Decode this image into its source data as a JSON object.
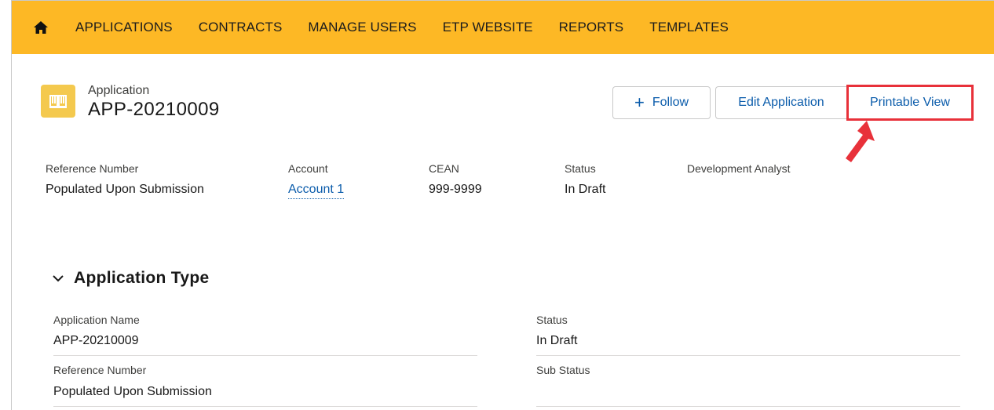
{
  "nav": {
    "home_icon": "home-icon",
    "items": [
      "APPLICATIONS",
      "CONTRACTS",
      "MANAGE USERS",
      "ETP WEBSITE",
      "REPORTS",
      "TEMPLATES"
    ],
    "background": "#fdb825"
  },
  "header": {
    "object_label": "Application",
    "record_name": "APP-20210009",
    "icon": "book-icon",
    "actions": {
      "follow_label": "Follow",
      "edit_label": "Edit Application",
      "printable_label": "Printable View"
    }
  },
  "highlights": {
    "reference_number": {
      "label": "Reference Number",
      "value": "Populated Upon Submission"
    },
    "account": {
      "label": "Account",
      "value": "Account 1"
    },
    "cean": {
      "label": "CEAN",
      "value": "999-9999"
    },
    "status": {
      "label": "Status",
      "value": "In Draft"
    },
    "development_analyst": {
      "label": "Development Analyst",
      "value": ""
    }
  },
  "section": {
    "title": "Application Type",
    "fields": {
      "application_name": {
        "label": "Application Name",
        "value": "APP-20210009"
      },
      "status": {
        "label": "Status",
        "value": "In Draft"
      },
      "reference_number": {
        "label": "Reference Number",
        "value": "Populated Upon Submission"
      },
      "sub_status": {
        "label": "Sub Status",
        "value": ""
      }
    }
  },
  "colors": {
    "accent_link": "#0b5cab",
    "callout_red": "#e8313a",
    "record_icon": "#f4c94e"
  }
}
